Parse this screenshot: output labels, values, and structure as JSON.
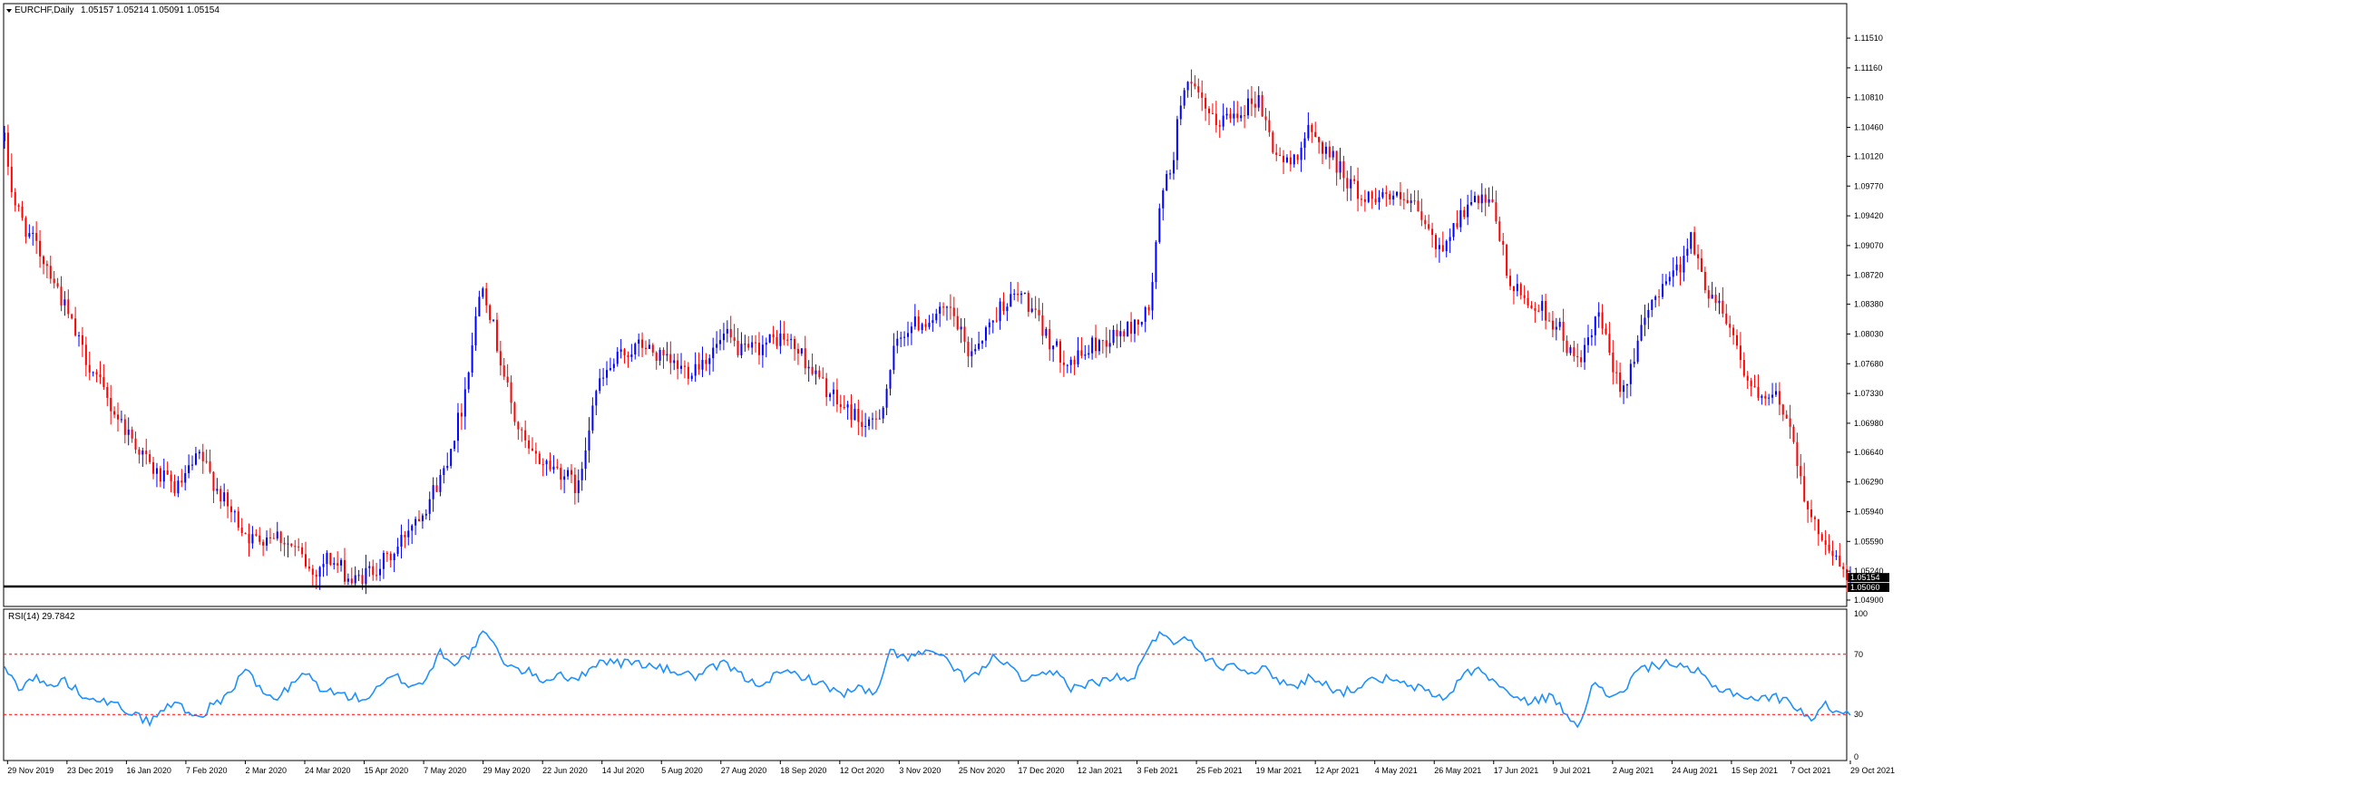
{
  "header": {
    "symbol_label": "EURCHF,Daily",
    "ohlc_label": "1.05157 1.05214 1.05091 1.05154"
  },
  "price_axis": {
    "labels": [
      "1.11510",
      "1.11160",
      "1.10810",
      "1.10460",
      "1.10120",
      "1.09770",
      "1.09420",
      "1.09070",
      "1.08720",
      "1.08380",
      "1.08030",
      "1.07680",
      "1.07330",
      "1.06980",
      "1.06640",
      "1.06290",
      "1.05940",
      "1.05590",
      "1.05240",
      "1.04900"
    ],
    "current_price_label": "1.05154",
    "support_price_label": "1.05060"
  },
  "rsi": {
    "label": "RSI(14) 29.7842",
    "axis_labels": [
      "100",
      "70",
      "30",
      "0"
    ],
    "levels": [
      70,
      30
    ]
  },
  "time_axis": {
    "labels": [
      "29 Nov 2019",
      "23 Dec 2019",
      "16 Jan 2020",
      "7 Feb 2020",
      "2 Mar 2020",
      "24 Mar 2020",
      "15 Apr 2020",
      "7 May 2020",
      "29 May 2020",
      "22 Jun 2020",
      "14 Jul 2020",
      "5 Aug 2020",
      "27 Aug 2020",
      "18 Sep 2020",
      "12 Oct 2020",
      "3 Nov 2020",
      "25 Nov 2020",
      "17 Dec 2020",
      "12 Jan 2021",
      "3 Feb 2021",
      "25 Feb 2021",
      "19 Mar 2021",
      "12 Apr 2021",
      "4 May 2021",
      "26 May 2021",
      "17 Jun 2021",
      "9 Jul 2021",
      "2 Aug 2021",
      "24 Aug 2021",
      "15 Sep 2021",
      "7 Oct 2021",
      "29 Oct 2021"
    ]
  },
  "colors": {
    "bull": "#0000ff",
    "bear": "#ff0000",
    "rsi_line": "#1e90ff",
    "level_line": "#ff0000",
    "support_line": "#000000"
  },
  "chart_data": {
    "type": "candlestick",
    "symbol": "EURCHF",
    "timeframe": "Daily",
    "y_range": [
      1.049,
      1.1166
    ],
    "support_level": 1.0506,
    "price_path": [
      [
        0,
        1.103
      ],
      [
        6,
        1.096
      ],
      [
        16,
        1.092
      ],
      [
        30,
        1.088
      ],
      [
        50,
        1.079
      ],
      [
        70,
        1.072
      ],
      [
        85,
        1.068
      ],
      [
        100,
        1.064
      ],
      [
        115,
        1.062
      ],
      [
        130,
        1.066
      ],
      [
        148,
        1.06
      ],
      [
        165,
        1.056
      ],
      [
        180,
        1.057
      ],
      [
        196,
        1.0545
      ],
      [
        205,
        1.052
      ],
      [
        215,
        1.054
      ],
      [
        225,
        1.0525
      ],
      [
        232,
        1.051
      ],
      [
        248,
        1.053
      ],
      [
        260,
        1.0545
      ],
      [
        270,
        1.058
      ],
      [
        280,
        1.06
      ],
      [
        292,
        1.064
      ],
      [
        305,
        1.072
      ],
      [
        318,
        1.087
      ],
      [
        328,
        1.079
      ],
      [
        340,
        1.07
      ],
      [
        350,
        1.066
      ],
      [
        362,
        1.065
      ],
      [
        372,
        1.064
      ],
      [
        382,
        1.062
      ],
      [
        392,
        1.073
      ],
      [
        402,
        1.076
      ],
      [
        412,
        1.078
      ],
      [
        425,
        1.079
      ],
      [
        440,
        1.077
      ],
      [
        455,
        1.076
      ],
      [
        470,
        1.078
      ],
      [
        480,
        1.08
      ],
      [
        492,
        1.078
      ],
      [
        505,
        1.079
      ],
      [
        518,
        1.08
      ],
      [
        530,
        1.078
      ],
      [
        542,
        1.075
      ],
      [
        555,
        1.072
      ],
      [
        565,
        1.071
      ],
      [
        575,
        1.069
      ],
      [
        585,
        1.072
      ],
      [
        592,
        1.078
      ],
      [
        600,
        1.081
      ],
      [
        615,
        1.082
      ],
      [
        630,
        1.083
      ],
      [
        642,
        1.078
      ],
      [
        655,
        1.081
      ],
      [
        665,
        1.084
      ],
      [
        678,
        1.085
      ],
      [
        690,
        1.081
      ],
      [
        702,
        1.078
      ],
      [
        712,
        1.077
      ],
      [
        725,
        1.079
      ],
      [
        738,
        1.08
      ],
      [
        750,
        1.081
      ],
      [
        762,
        1.083
      ],
      [
        770,
        1.096
      ],
      [
        778,
        1.101
      ],
      [
        785,
        1.11
      ],
      [
        795,
        1.108
      ],
      [
        805,
        1.105
      ],
      [
        815,
        1.106
      ],
      [
        825,
        1.107
      ],
      [
        835,
        1.108
      ],
      [
        845,
        1.102
      ],
      [
        855,
        1.1
      ],
      [
        868,
        1.104
      ],
      [
        880,
        1.102
      ],
      [
        892,
        1.099
      ],
      [
        905,
        1.096
      ],
      [
        915,
        1.097
      ],
      [
        928,
        1.096
      ],
      [
        940,
        1.095
      ],
      [
        955,
        1.09
      ],
      [
        968,
        1.094
      ],
      [
        980,
        1.096
      ],
      [
        992,
        1.095
      ],
      [
        1002,
        1.086
      ],
      [
        1015,
        1.084
      ],
      [
        1025,
        1.083
      ],
      [
        1035,
        1.081
      ],
      [
        1045,
        1.077
      ],
      [
        1055,
        1.079
      ],
      [
        1062,
        1.083
      ],
      [
        1070,
        1.076
      ],
      [
        1078,
        1.074
      ],
      [
        1085,
        1.078
      ],
      [
        1095,
        1.083
      ],
      [
        1105,
        1.087
      ],
      [
        1115,
        1.088
      ],
      [
        1122,
        1.092
      ],
      [
        1132,
        1.086
      ],
      [
        1142,
        1.084
      ],
      [
        1150,
        1.081
      ],
      [
        1160,
        1.075
      ],
      [
        1170,
        1.072
      ],
      [
        1180,
        1.073
      ],
      [
        1188,
        1.07
      ],
      [
        1196,
        1.064
      ],
      [
        1202,
        1.058
      ],
      [
        1210,
        1.057
      ],
      [
        1218,
        1.054
      ],
      [
        1228,
        1.0515
      ]
    ],
    "rsi_path": [
      [
        0,
        60
      ],
      [
        10,
        48
      ],
      [
        20,
        55
      ],
      [
        30,
        48
      ],
      [
        40,
        53
      ],
      [
        50,
        44
      ],
      [
        60,
        42
      ],
      [
        70,
        37
      ],
      [
        80,
        34
      ],
      [
        90,
        28
      ],
      [
        97,
        25
      ],
      [
        105,
        33
      ],
      [
        115,
        38
      ],
      [
        125,
        30
      ],
      [
        130,
        28
      ],
      [
        140,
        38
      ],
      [
        150,
        43
      ],
      [
        160,
        62
      ],
      [
        170,
        46
      ],
      [
        180,
        40
      ],
      [
        190,
        48
      ],
      [
        200,
        58
      ],
      [
        210,
        48
      ],
      [
        220,
        44
      ],
      [
        230,
        42
      ],
      [
        240,
        40
      ],
      [
        250,
        48
      ],
      [
        260,
        56
      ],
      [
        270,
        49
      ],
      [
        280,
        52
      ],
      [
        290,
        72
      ],
      [
        300,
        64
      ],
      [
        310,
        70
      ],
      [
        320,
        86
      ],
      [
        330,
        68
      ],
      [
        340,
        60
      ],
      [
        350,
        58
      ],
      [
        360,
        52
      ],
      [
        370,
        58
      ],
      [
        380,
        51
      ],
      [
        390,
        62
      ],
      [
        400,
        66
      ],
      [
        410,
        64
      ],
      [
        420,
        65
      ],
      [
        430,
        62
      ],
      [
        440,
        60
      ],
      [
        450,
        58
      ],
      [
        460,
        55
      ],
      [
        470,
        60
      ],
      [
        480,
        64
      ],
      [
        490,
        56
      ],
      [
        500,
        50
      ],
      [
        510,
        54
      ],
      [
        520,
        58
      ],
      [
        530,
        56
      ],
      [
        540,
        52
      ],
      [
        550,
        47
      ],
      [
        560,
        44
      ],
      [
        570,
        48
      ],
      [
        580,
        42
      ],
      [
        590,
        72
      ],
      [
        600,
        68
      ],
      [
        610,
        70
      ],
      [
        620,
        72
      ],
      [
        630,
        62
      ],
      [
        640,
        54
      ],
      [
        650,
        58
      ],
      [
        660,
        70
      ],
      [
        670,
        60
      ],
      [
        680,
        52
      ],
      [
        690,
        55
      ],
      [
        700,
        58
      ],
      [
        710,
        48
      ],
      [
        720,
        50
      ],
      [
        730,
        52
      ],
      [
        740,
        55
      ],
      [
        750,
        52
      ],
      [
        760,
        70
      ],
      [
        770,
        86
      ],
      [
        780,
        78
      ],
      [
        790,
        80
      ],
      [
        800,
        68
      ],
      [
        810,
        62
      ],
      [
        820,
        64
      ],
      [
        830,
        58
      ],
      [
        840,
        60
      ],
      [
        850,
        52
      ],
      [
        860,
        48
      ],
      [
        870,
        56
      ],
      [
        880,
        50
      ],
      [
        890,
        44
      ],
      [
        900,
        48
      ],
      [
        910,
        52
      ],
      [
        920,
        54
      ],
      [
        930,
        50
      ],
      [
        940,
        48
      ],
      [
        950,
        44
      ],
      [
        960,
        40
      ],
      [
        970,
        56
      ],
      [
        980,
        60
      ],
      [
        990,
        54
      ],
      [
        1000,
        45
      ],
      [
        1010,
        38
      ],
      [
        1020,
        40
      ],
      [
        1030,
        42
      ],
      [
        1040,
        30
      ],
      [
        1048,
        24
      ],
      [
        1058,
        50
      ],
      [
        1068,
        42
      ],
      [
        1078,
        46
      ],
      [
        1088,
        60
      ],
      [
        1098,
        62
      ],
      [
        1108,
        65
      ],
      [
        1118,
        60
      ],
      [
        1128,
        58
      ],
      [
        1138,
        48
      ],
      [
        1148,
        46
      ],
      [
        1158,
        42
      ],
      [
        1168,
        40
      ],
      [
        1178,
        42
      ],
      [
        1188,
        38
      ],
      [
        1196,
        34
      ],
      [
        1202,
        26
      ],
      [
        1212,
        36
      ],
      [
        1220,
        33
      ],
      [
        1228,
        30
      ]
    ],
    "rsi_last": 29.7842
  }
}
